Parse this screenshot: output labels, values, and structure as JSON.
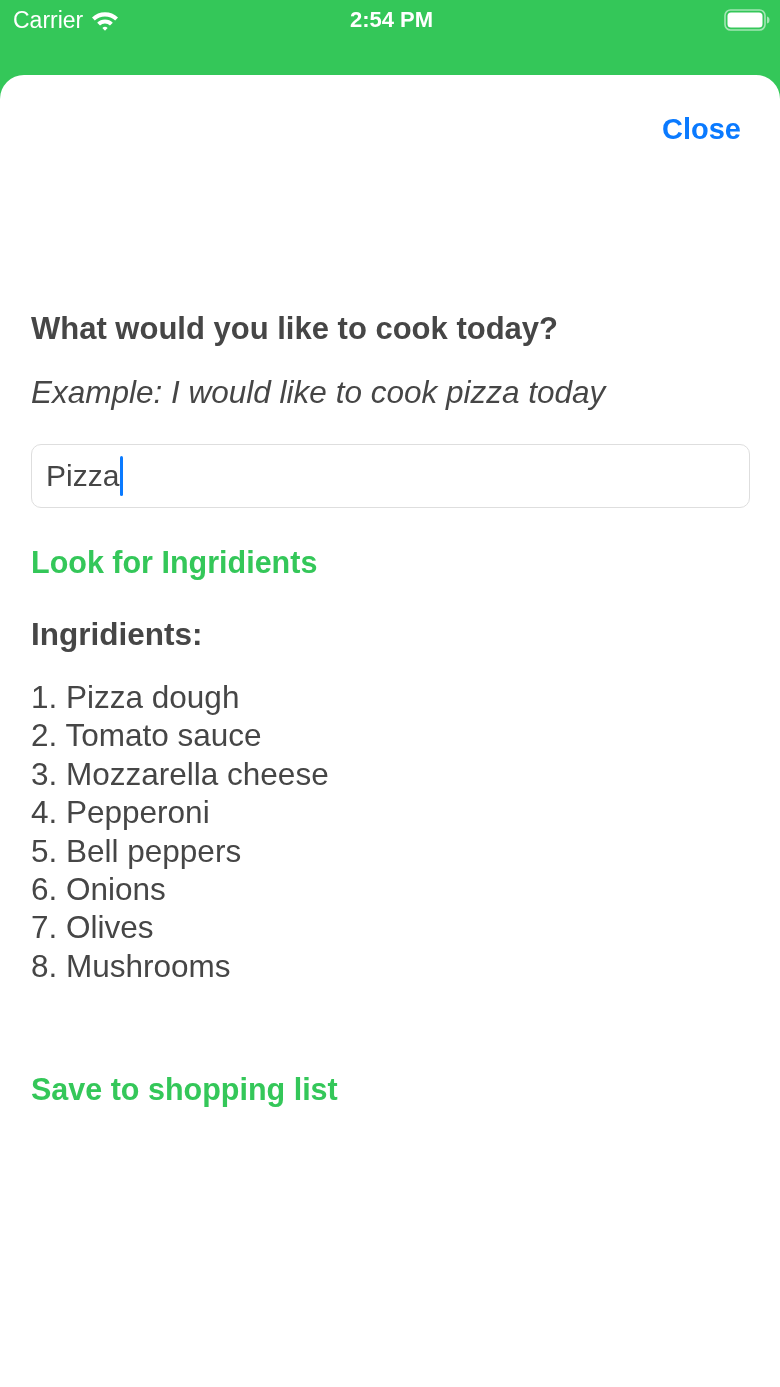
{
  "status_bar": {
    "carrier": "Carrier",
    "time": "2:54 PM"
  },
  "sheet": {
    "close_button": "Close",
    "question": "What would you like to cook today?",
    "example": "Example: I would like to cook pizza today",
    "input": {
      "value": "Pizza",
      "focused": true
    },
    "search_button": "Look for Ingridients",
    "ingredients_heading": "Ingridients:",
    "ingredients": [
      "1. Pizza dough",
      "2. Tomato sauce",
      "3. Mozzarella cheese",
      "4. Pepperoni",
      "5. Bell peppers",
      "6. Onions",
      "7. Olives",
      "8. Mushrooms"
    ],
    "save_button": "Save to shopping list"
  }
}
